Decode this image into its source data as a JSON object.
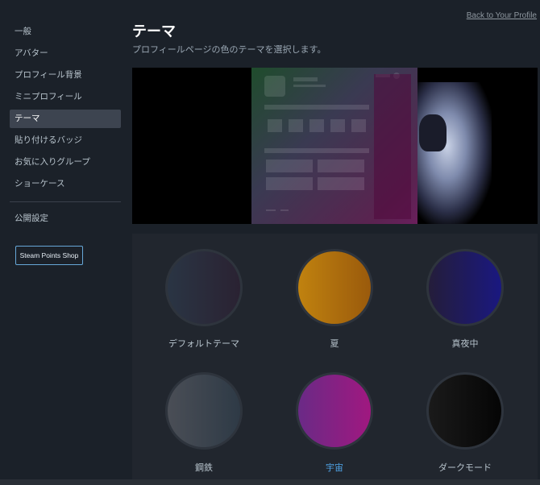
{
  "header": {
    "back_link": "Back to Your Profile"
  },
  "sidebar": {
    "items": [
      {
        "label": "一般"
      },
      {
        "label": "アバター"
      },
      {
        "label": "プロフィール背景"
      },
      {
        "label": "ミニプロフィール"
      },
      {
        "label": "テーマ"
      },
      {
        "label": "貼り付けるバッジ"
      },
      {
        "label": "お気に入りグループ"
      },
      {
        "label": "ショーケース"
      }
    ],
    "privacy_label": "公開設定",
    "points_shop_label": "Steam Points Shop"
  },
  "main": {
    "title": "テーマ",
    "subtitle": "プロフィールページの色のテーマを選択します。"
  },
  "themes": [
    {
      "label": "デフォルトテーマ",
      "colors": [
        "#2a3544",
        "#2a2232"
      ]
    },
    {
      "label": "夏",
      "colors": [
        "#c0820f",
        "#9a5a0c"
      ]
    },
    {
      "label": "真夜中",
      "colors": [
        "#241d3a",
        "#1a1880"
      ]
    },
    {
      "label": "鋼鉄",
      "colors": [
        "#4a4e56",
        "#2e3a46"
      ]
    },
    {
      "label": "宇宙",
      "colors": [
        "#6a2a86",
        "#a01880"
      ],
      "selected": true
    },
    {
      "label": "ダークモード",
      "colors": [
        "#1a1a1a",
        "#050505"
      ]
    }
  ]
}
